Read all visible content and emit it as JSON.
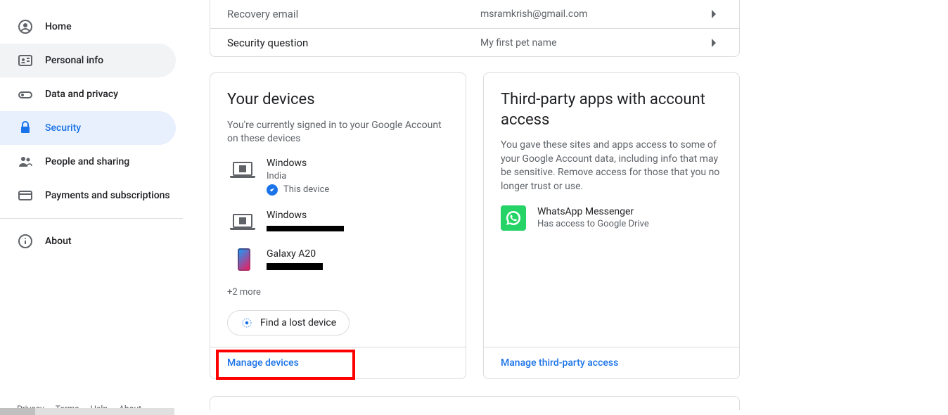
{
  "sidebar": {
    "items": [
      {
        "label": "Home"
      },
      {
        "label": "Personal info"
      },
      {
        "label": "Data and privacy"
      },
      {
        "label": "Security"
      },
      {
        "label": "People and sharing"
      },
      {
        "label": "Payments and subscriptions"
      },
      {
        "label": "About"
      }
    ]
  },
  "footer": {
    "privacy": "Privacy",
    "terms": "Terms",
    "help": "Help",
    "about": "About"
  },
  "recovery_rows": [
    {
      "label": "Recovery email",
      "value": "msramkrish@gmail.com"
    },
    {
      "label": "Security question",
      "value": "My first pet name"
    }
  ],
  "devices_card": {
    "title": "Your devices",
    "desc": "You're currently signed in to your Google Account on these devices",
    "devices": [
      {
        "name": "Windows",
        "sub": "India",
        "this_device": true,
        "this_device_label": "This device"
      },
      {
        "name": "Windows",
        "redacted": true
      },
      {
        "name": "Galaxy A20",
        "redacted": true
      }
    ],
    "more": "+2 more",
    "find_lost": "Find a lost device",
    "manage": "Manage devices"
  },
  "apps_card": {
    "title": "Third-party apps with account access",
    "desc": "You gave these sites and apps access to some of your Google Account data, including info that may be sensitive. Remove access for those that you no longer trust or use.",
    "apps": [
      {
        "name": "WhatsApp Messenger",
        "sub": "Has access to Google Drive"
      }
    ],
    "manage": "Manage third-party access"
  }
}
